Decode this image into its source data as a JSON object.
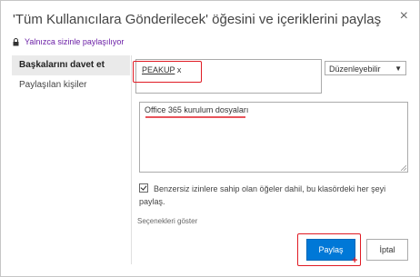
{
  "dialog": {
    "title": "'Tüm Kullanıcılara Gönderilecek' öğesini ve içeriklerini paylaş",
    "close_glyph": "×",
    "shared_with_text": "Yalnızca sizinle paylaşılıyor"
  },
  "nav": {
    "items": [
      {
        "label": "Başkalarını davet et",
        "active": true
      },
      {
        "label": "Paylaşılan kişiler",
        "active": false
      }
    ]
  },
  "people_picker": {
    "chip_label": "PEAKUP",
    "chip_remove": "x"
  },
  "permission": {
    "selected": "Düzenleyebilir",
    "arrow": "▼"
  },
  "message": {
    "value": "Office 365 kurulum dosyaları"
  },
  "options": {
    "include_unique_label": "Benzersiz izinlere sahip olan öğeler dahil, bu klasördeki her şeyi paylaş.",
    "show_options_label": "Seçenekleri göster"
  },
  "buttons": {
    "share_label": "Paylaş",
    "cancel_label": "İptal"
  },
  "annotation": {
    "plus_glyph": "+",
    "highlight_color": "#e01b24"
  },
  "colors": {
    "primary_button": "#0078d7",
    "link_purple": "#6b1fa6"
  },
  "icons": {
    "lock": "lock-icon",
    "close": "close-icon",
    "dropdown": "chevron-down-icon",
    "checkbox": "checkbox-checked"
  }
}
